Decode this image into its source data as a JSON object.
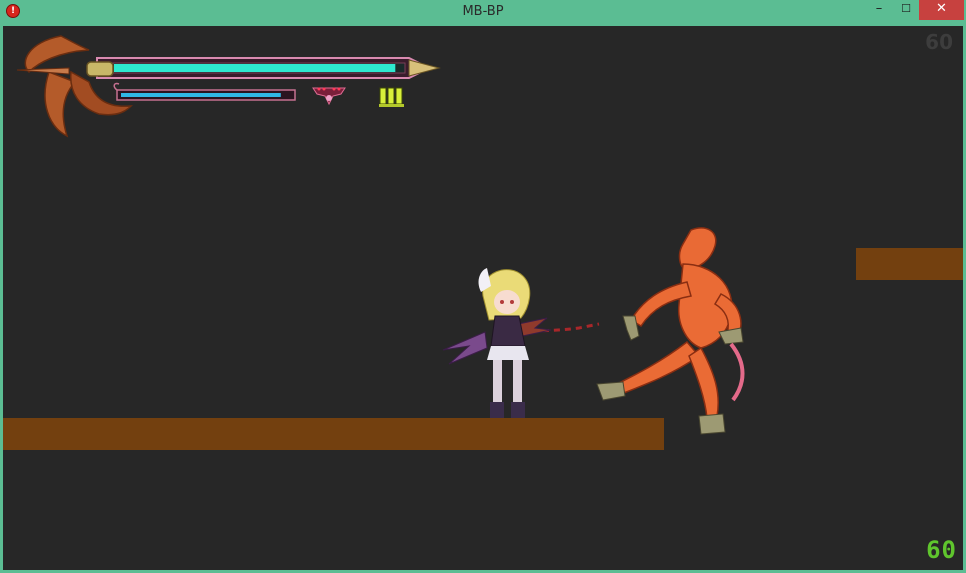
{
  "window": {
    "title": "MB-BP",
    "app_icon": "app-red-orb-icon",
    "controls": {
      "minimize": "–",
      "maximize": "☐",
      "close": "✕"
    }
  },
  "hud": {
    "health_ratio": 0.97,
    "mana_ratio": 0.94,
    "ammo_count": 3,
    "colors": {
      "health": "#2ee8d0",
      "mana": "#2fb7e6",
      "ammo": "#d8f03a",
      "blade": "#b45b2a"
    }
  },
  "counters": {
    "fps_top": "60",
    "fps_bottom": "60"
  },
  "colors": {
    "background": "#272727",
    "platform": "#73400f",
    "frame": "#5bbd93"
  }
}
